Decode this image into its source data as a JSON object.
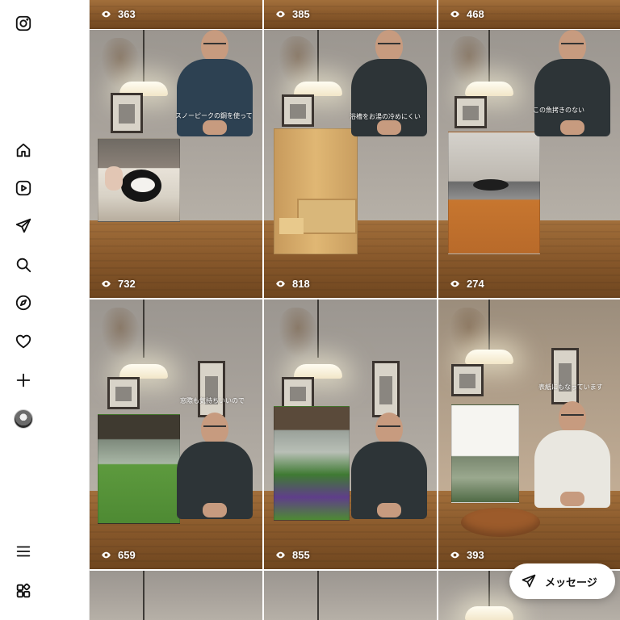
{
  "sidebar": {
    "items": [
      {
        "name": "instagram-logo-icon"
      },
      {
        "name": "home-icon"
      },
      {
        "name": "reels-icon"
      },
      {
        "name": "direct-message-icon"
      },
      {
        "name": "search-icon"
      },
      {
        "name": "explore-icon"
      },
      {
        "name": "notifications-heart-icon"
      },
      {
        "name": "create-plus-icon"
      },
      {
        "name": "profile-avatar"
      },
      {
        "name": "menu-icon"
      },
      {
        "name": "more-apps-icon"
      }
    ]
  },
  "grid": {
    "top_row": [
      {
        "views": "363"
      },
      {
        "views": "385"
      },
      {
        "views": "468"
      }
    ],
    "row1": [
      {
        "views": "732",
        "caption": "スノーピークの鋼を使って"
      },
      {
        "views": "818",
        "caption": "浴槽をお湯の冷めにくい"
      },
      {
        "views": "274",
        "caption": "この魚拷きのない"
      }
    ],
    "row2": [
      {
        "views": "659",
        "caption": "窓際も気持ちいいので"
      },
      {
        "views": "855",
        "caption": ""
      },
      {
        "views": "393",
        "caption": "表紙にもなっています"
      }
    ]
  },
  "message_button": {
    "label": "メッセージ"
  },
  "colors": {
    "views_text": "#ffffff",
    "table_wood": "#8a5a2c",
    "wall": "#a9a39c"
  }
}
